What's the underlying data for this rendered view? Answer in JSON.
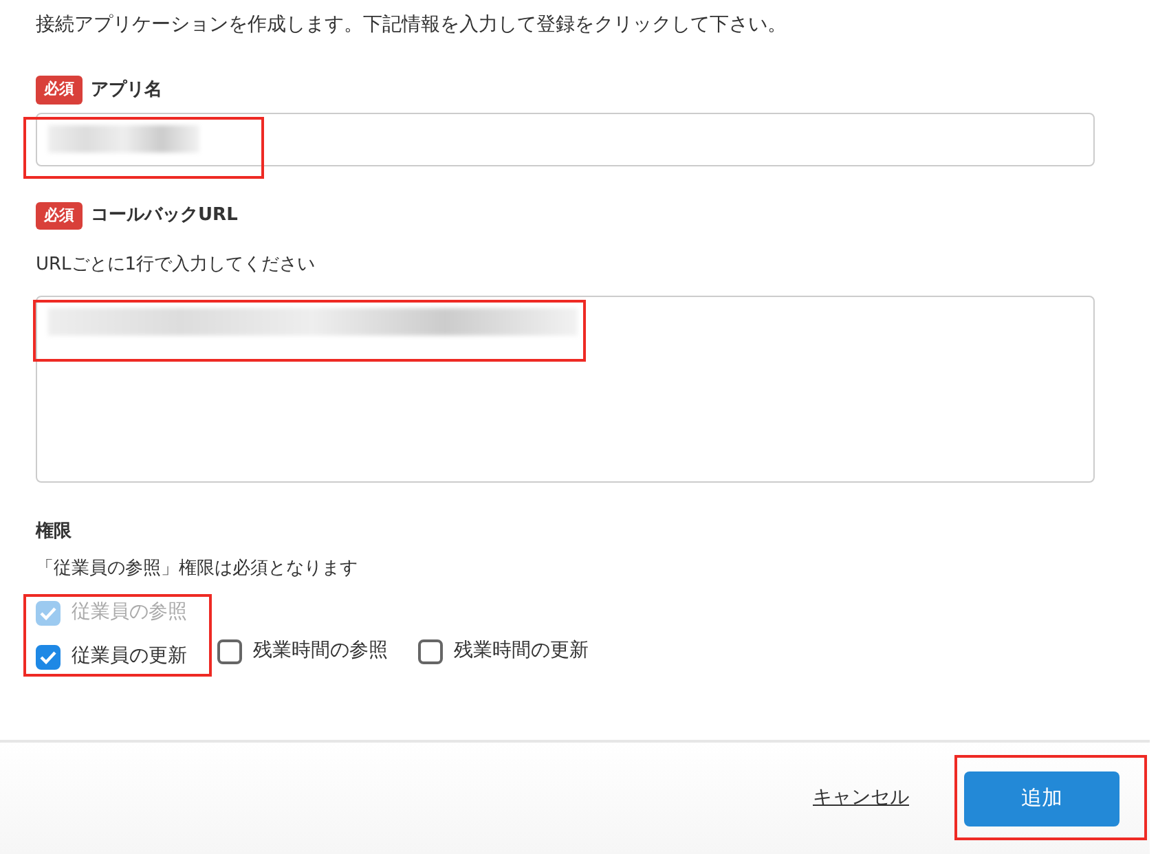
{
  "intro": "接続アプリケーションを作成します。下記情報を入力して登録をクリックして下さい。",
  "fields": [
    {
      "kind": "input",
      "required_badge": "必須",
      "label": "アプリ名"
    },
    {
      "kind": "textarea",
      "required_badge": "必須",
      "label": "コールバックURL",
      "hint": "URLごとに1行で入力してください"
    }
  ],
  "permissions": {
    "label": "権限",
    "hint": "「従業員の参照」権限は必須となります",
    "options": [
      {
        "label": "従業員の参照",
        "checked": true,
        "disabled": true
      },
      {
        "label": "従業員の更新",
        "checked": true,
        "disabled": false
      },
      {
        "label": "残業時間の参照",
        "checked": false,
        "disabled": false
      },
      {
        "label": "残業時間の更新",
        "checked": false,
        "disabled": false
      }
    ]
  },
  "footer": {
    "cancel": "キャンセル",
    "submit": "追加"
  }
}
